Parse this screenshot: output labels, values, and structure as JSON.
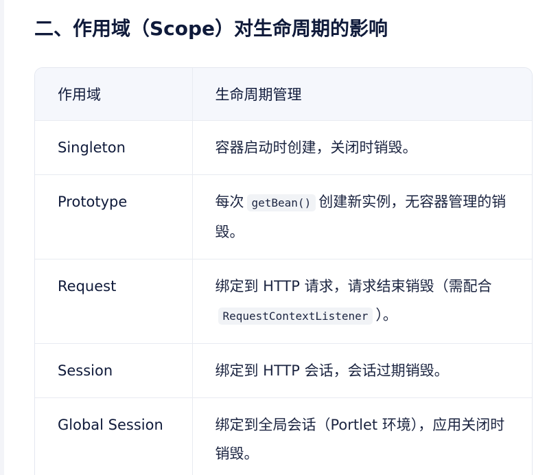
{
  "title": "二、作用域（Scope）对生命周期的影响",
  "table": {
    "headers": [
      "作用域",
      "生命周期管理"
    ],
    "rows": [
      {
        "scope": "Singleton",
        "desc": {
          "before": "容器启动时创建，关闭时销毁。",
          "code": "",
          "after": ""
        }
      },
      {
        "scope": "Prototype",
        "desc": {
          "before": "每次",
          "code": "getBean()",
          "after": "创建新实例，无容器管理的销毁。"
        }
      },
      {
        "scope": "Request",
        "desc": {
          "before": "绑定到 HTTP 请求，请求结束销毁（需配合",
          "code": "RequestContextListener",
          "after": "）。"
        }
      },
      {
        "scope": "Session",
        "desc": {
          "before": "绑定到 HTTP 会话，会话过期销毁。",
          "code": "",
          "after": ""
        }
      },
      {
        "scope": "Global Session",
        "desc": {
          "before": "绑定到全局会话（Portlet 环境），应用关闭时销毁。",
          "code": "",
          "after": ""
        }
      }
    ]
  }
}
